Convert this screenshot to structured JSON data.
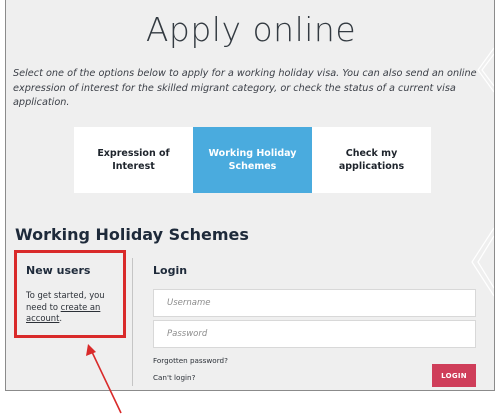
{
  "page": {
    "title": "Apply online",
    "intro": "Select one of the options below to apply for a working holiday visa. You can also send an online expression of interest for the skilled migrant category, or check the status of a current visa application."
  },
  "tabs": [
    {
      "label": "Expression of Interest",
      "active": false
    },
    {
      "label": "Working Holiday Schemes",
      "active": true
    },
    {
      "label": "Check my applications",
      "active": false
    }
  ],
  "section": {
    "heading": "Working Holiday Schemes"
  },
  "new_users": {
    "title": "New users",
    "text_before": "To get started, you need to ",
    "link": "create an account",
    "text_after": "."
  },
  "login": {
    "title": "Login",
    "username_placeholder": "Username",
    "password_placeholder": "Password",
    "forgot_password": "Forgotten password?",
    "cant_login": "Can't login?",
    "button": "LOGIN"
  },
  "colors": {
    "active_tab": "#4aabde",
    "login_button": "#cf3e5a",
    "highlight": "#d92a2a"
  }
}
